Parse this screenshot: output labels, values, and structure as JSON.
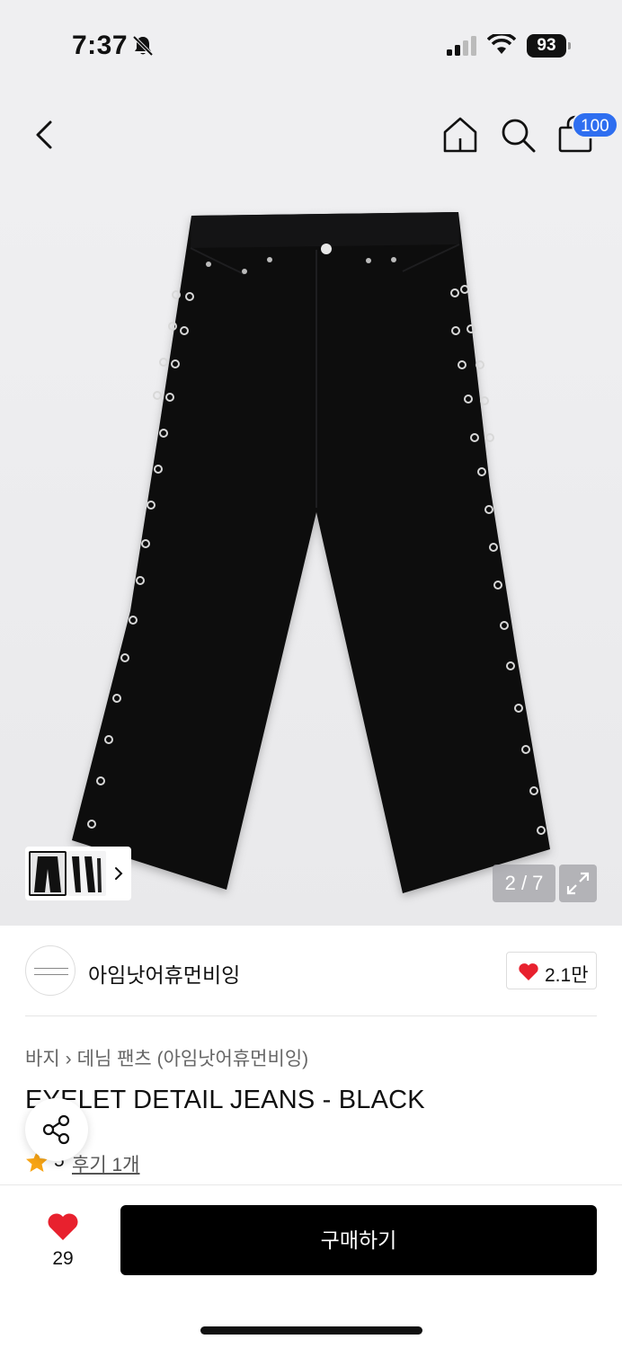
{
  "status": {
    "time": "7:37",
    "battery": "93"
  },
  "header": {
    "cart_count": "100",
    "icons": [
      "back-icon",
      "home-icon",
      "search-icon",
      "cart-icon"
    ]
  },
  "gallery": {
    "page_indicator": "2 / 7"
  },
  "brand": {
    "name": "아임낫어휴먼비잉",
    "likes": "2.1만"
  },
  "breadcrumb": {
    "category": "바지",
    "subcategory": "데님 팬츠 (아임낫어휴먼비잉)"
  },
  "product": {
    "title": "EYELET DETAIL JEANS - BLACK",
    "rating": "5",
    "reviews": "후기 1개"
  },
  "bottom": {
    "wish_count": "29",
    "buy_label": "구매하기"
  },
  "colors": {
    "accent": "#2e6ef0",
    "heart": "#e8212e",
    "star": "#f7a414",
    "button": "#000000"
  }
}
